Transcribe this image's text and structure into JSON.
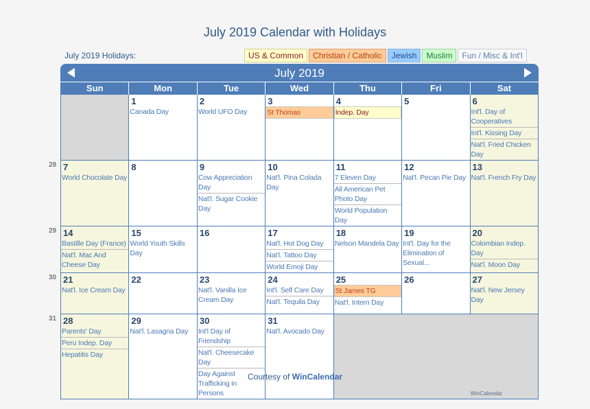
{
  "page": {
    "title": "July 2019 Calendar with Holidays",
    "holidays_label": "July 2019 Holidays:",
    "courtesy_prefix": "Courtesy of",
    "courtesy_brand": "WinCalendar",
    "watermark": "WinCalendar"
  },
  "legend": [
    {
      "label": "US & Common",
      "category": "us",
      "bg": "#ffffcc"
    },
    {
      "label": "Christian / Catholic",
      "category": "christian",
      "bg": "#ffcc99"
    },
    {
      "label": "Jewish",
      "category": "jewish",
      "bg": "#99ccff"
    },
    {
      "label": "Muslim",
      "category": "muslim",
      "bg": "#ccffcc"
    },
    {
      "label": "Fun / Misc & Int'l",
      "category": "fun",
      "bg": "#f8f8f8"
    }
  ],
  "calendar": {
    "month_label": "July 2019",
    "prev_icon": "triangle-left-icon",
    "next_icon": "triangle-right-icon",
    "weekdays": [
      "Sun",
      "Mon",
      "Tue",
      "Wed",
      "Thu",
      "Fri",
      "Sat"
    ],
    "weeks": [
      {
        "week_number": "",
        "days": [
          null,
          {
            "day": "1",
            "events": [
              {
                "name": "Canada Day",
                "type": "fun"
              }
            ]
          },
          {
            "day": "2",
            "events": [
              {
                "name": "World UFO Day",
                "type": "fun"
              }
            ]
          },
          {
            "day": "3",
            "events": [
              {
                "name": "St Thomas",
                "type": "christian"
              }
            ]
          },
          {
            "day": "4",
            "events": [
              {
                "name": "Indep. Day",
                "type": "us"
              }
            ]
          },
          {
            "day": "5",
            "events": []
          },
          {
            "day": "6",
            "events": [
              {
                "name": "Int'l. Day of Cooperatives",
                "type": "fun"
              },
              {
                "name": "Int'l. Kissing Day",
                "type": "fun"
              },
              {
                "name": "Nat'l. Fried Chicken Day",
                "type": "fun"
              }
            ]
          }
        ]
      },
      {
        "week_number": "28",
        "days": [
          {
            "day": "7",
            "events": [
              {
                "name": "World Chocolate Day",
                "type": "fun"
              }
            ]
          },
          {
            "day": "8",
            "events": []
          },
          {
            "day": "9",
            "events": [
              {
                "name": "Cow Appreciation Day",
                "type": "fun"
              },
              {
                "name": "Nat'l. Sugar Cookie Day",
                "type": "fun"
              }
            ]
          },
          {
            "day": "10",
            "events": [
              {
                "name": "Nat'l. Pina Colada Day",
                "type": "fun"
              }
            ]
          },
          {
            "day": "11",
            "events": [
              {
                "name": "7 Eleven Day",
                "type": "fun"
              },
              {
                "name": "All American Pet Photo Day",
                "type": "fun"
              },
              {
                "name": "World Population Day",
                "type": "fun"
              }
            ]
          },
          {
            "day": "12",
            "events": [
              {
                "name": "Nat'l. Pecan Pie Day",
                "type": "fun"
              }
            ]
          },
          {
            "day": "13",
            "events": [
              {
                "name": "Nat'l. French Fry Day",
                "type": "fun"
              }
            ]
          }
        ]
      },
      {
        "week_number": "29",
        "days": [
          {
            "day": "14",
            "events": [
              {
                "name": "Bastille Day (France)",
                "type": "fun"
              },
              {
                "name": "Nat'l. Mac And Cheese Day",
                "type": "fun"
              }
            ]
          },
          {
            "day": "15",
            "events": [
              {
                "name": "World Youth Skills Day",
                "type": "fun"
              }
            ]
          },
          {
            "day": "16",
            "events": []
          },
          {
            "day": "17",
            "events": [
              {
                "name": "Nat'l. Hot Dog Day",
                "type": "fun"
              },
              {
                "name": "Nat'l. Tattoo Day",
                "type": "fun"
              },
              {
                "name": "World Emoji Day",
                "type": "fun"
              }
            ]
          },
          {
            "day": "18",
            "events": [
              {
                "name": "Nelson Mandela Day",
                "type": "fun"
              }
            ]
          },
          {
            "day": "19",
            "events": [
              {
                "name": "Int'l. Day for the Elimination of Sexual...",
                "type": "fun"
              }
            ]
          },
          {
            "day": "20",
            "events": [
              {
                "name": "Colombian Indep. Day",
                "type": "fun"
              },
              {
                "name": "Nat'l. Moon Day",
                "type": "fun"
              }
            ]
          }
        ]
      },
      {
        "week_number": "30",
        "days": [
          {
            "day": "21",
            "events": [
              {
                "name": "Nat'l. Ice Cream Day",
                "type": "fun"
              }
            ]
          },
          {
            "day": "22",
            "events": []
          },
          {
            "day": "23",
            "events": [
              {
                "name": "Nat'l. Vanilla Ice Cream Day",
                "type": "fun"
              }
            ]
          },
          {
            "day": "24",
            "events": [
              {
                "name": "Int'l. Self Care Day",
                "type": "fun"
              },
              {
                "name": "Nat'l. Tequila Day",
                "type": "fun"
              }
            ]
          },
          {
            "day": "25",
            "events": [
              {
                "name": "St James TG",
                "type": "christian"
              },
              {
                "name": "Nat'l. Intern Day",
                "type": "fun"
              }
            ]
          },
          {
            "day": "26",
            "events": []
          },
          {
            "day": "27",
            "events": [
              {
                "name": "Nat'l. New Jersey Day",
                "type": "fun"
              }
            ]
          }
        ]
      },
      {
        "week_number": "31",
        "days": [
          {
            "day": "28",
            "events": [
              {
                "name": "Parents' Day",
                "type": "fun"
              },
              {
                "name": "Peru Indep. Day",
                "type": "fun"
              },
              {
                "name": "Hepatitis Day",
                "type": "fun"
              }
            ]
          },
          {
            "day": "29",
            "events": [
              {
                "name": "Nat'l. Lasagna Day",
                "type": "fun"
              }
            ]
          },
          {
            "day": "30",
            "events": [
              {
                "name": "Int'l Day of Friendship",
                "type": "fun"
              },
              {
                "name": "Nat'l. Cheesecake Day",
                "type": "fun"
              },
              {
                "name": "Day Against Trafficking in Persons",
                "type": "fun"
              }
            ]
          },
          {
            "day": "31",
            "events": [
              {
                "name": "Nat'l. Avocado Day",
                "type": "fun"
              }
            ]
          },
          null,
          null,
          null
        ]
      }
    ]
  }
}
